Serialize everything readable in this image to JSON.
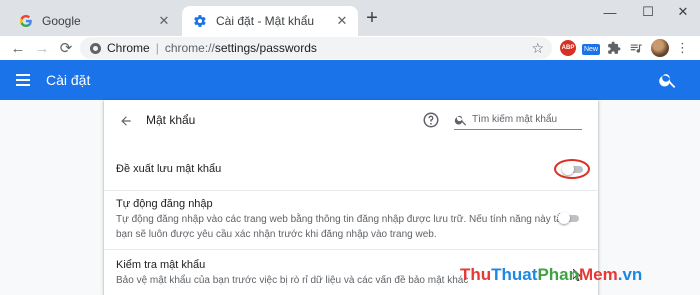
{
  "browser": {
    "tabs": [
      {
        "title": "Google",
        "icon": "google-g-icon",
        "active": false
      },
      {
        "title": "Cài đặt - Mật khẩu",
        "icon": "settings-gear-icon",
        "active": true
      }
    ],
    "new_tab": "+",
    "window_controls": {
      "minimize": "—",
      "maximize": "☐",
      "close": "✕"
    },
    "toolbar": {
      "back": "←",
      "forward": "→",
      "reload": "⟳",
      "origin": "Chrome",
      "separator": "|",
      "url_scheme": "chrome://",
      "url_path": "settings/passwords",
      "bookmark_icon": "star-icon",
      "extensions": [
        {
          "name": "adblock-plus-icon",
          "text": "ABP"
        },
        {
          "name": "new-badge-icon",
          "text": "New"
        },
        {
          "name": "puzzle-extensions-icon"
        },
        {
          "name": "media-queue-icon"
        }
      ],
      "menu": "⋮"
    }
  },
  "settings": {
    "header_title": "Cài đặt",
    "accent_color": "#1a73e8"
  },
  "passwords": {
    "page_title": "Mật khẩu",
    "search_placeholder": "Tìm kiếm mật khẩu",
    "rows": [
      {
        "label": "Đề xuất lưu mật khẩu",
        "toggle": "off",
        "highlighted": true
      },
      {
        "label": "Tự động đăng nhập",
        "description_line1": "Tự động đăng nhập vào các trang web bằng thông tin đăng nhập được lưu trữ. Nếu tính năng này tắt,",
        "description_line2": "bạn sẽ luôn được yêu cầu xác nhận trước khi đăng nhập vào trang web.",
        "toggle": "off"
      },
      {
        "label": "Kiểm tra mật khẩu",
        "description_line1": "Bảo vệ mật khẩu của bạn trước việc bị rò rỉ dữ liệu và các vấn đề bảo mật khác"
      }
    ],
    "highlight_color": "#d93025"
  },
  "watermark": {
    "parts": [
      "Thu",
      "Thuat",
      "Phan",
      "Mem",
      ".vn"
    ]
  }
}
